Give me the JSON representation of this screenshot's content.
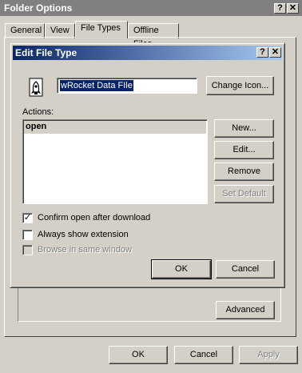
{
  "outer_window": {
    "title": "Folder Options",
    "help_btn": "?",
    "close_btn": "✕",
    "tabs": [
      "General",
      "View",
      "File Types",
      "Offline Files"
    ],
    "advanced_label": "Advanced",
    "ok_label": "OK",
    "cancel_label": "Cancel",
    "apply_label": "Apply"
  },
  "dialog": {
    "title": "Edit File Type",
    "help_btn": "?",
    "close_btn": "✕",
    "icon_name": "wrocket-file-icon",
    "name_value": "wRocket Data FIle",
    "change_icon_label": "Change Icon...",
    "actions_label": "Actions:",
    "actions": [
      "open"
    ],
    "new_label": "New...",
    "edit_label": "Edit...",
    "remove_label": "Remove",
    "set_default_label": "Set Default",
    "checkboxes": [
      {
        "label": "Confirm open after download",
        "checked": true,
        "enabled": true
      },
      {
        "label": "Always show extension",
        "checked": false,
        "enabled": true
      },
      {
        "label": "Browse in same window",
        "checked": false,
        "enabled": false
      }
    ],
    "ok_label": "OK",
    "cancel_label": "Cancel"
  }
}
